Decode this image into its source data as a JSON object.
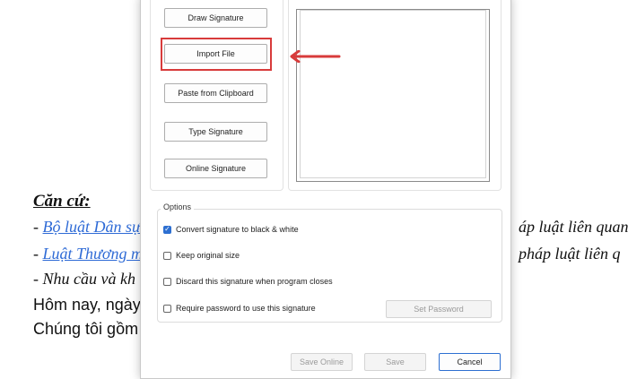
{
  "document": {
    "heading": "Căn cứ:",
    "line1_prefix": "- ",
    "line1_link": "Bộ luật Dân sự",
    "line1_right": "áp luật liên quan",
    "line2_prefix": "- ",
    "line2_link": "Luật Thương m",
    "line2_right": "pháp luật liên q",
    "line3": "- Nhu cầu và kh",
    "line4": "Hôm nay, ngày",
    "line5": "Chúng tôi gồm"
  },
  "dialog": {
    "buttons": {
      "draw": "Draw Signature",
      "import": "Import File",
      "paste": "Paste from Clipboard",
      "type": "Type Signature",
      "online": "Online Signature"
    },
    "options": {
      "legend": "Options",
      "convert": {
        "label": "Convert signature to black & white",
        "checked": true
      },
      "keep": {
        "label": "Keep original size",
        "checked": false
      },
      "discard": {
        "label": "Discard this signature when program closes",
        "checked": false
      },
      "require": {
        "label": "Require password to use this signature",
        "checked": false
      },
      "set_password": "Set Password"
    },
    "footer": {
      "save_online": "Save Online",
      "save": "Save",
      "cancel": "Cancel"
    }
  },
  "colors": {
    "highlight": "#d83b3b",
    "arrow": "#d83b3b",
    "accent": "#2d6fd1"
  }
}
